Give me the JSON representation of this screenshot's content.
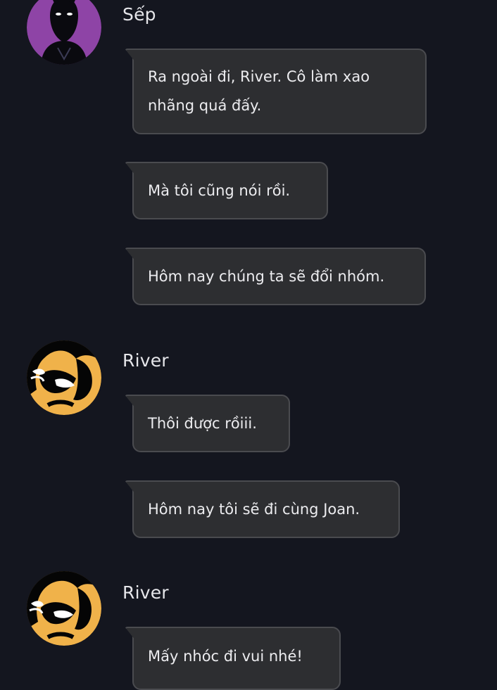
{
  "messages": [
    {
      "sender": "Sếp",
      "bubbles": [
        "Ra ngoài đi, River. Cô làm xao nhãng quá đấy.",
        "Mà tôi cũng nói rồi.",
        "Hôm nay chúng ta sẽ đổi nhóm."
      ]
    },
    {
      "sender": "River",
      "bubbles": [
        "Thôi được rồiii.",
        "Hôm nay tôi sẽ đi cùng Joan."
      ]
    },
    {
      "sender": "River",
      "bubbles": [
        "Mấy nhóc đi vui nhé!"
      ]
    }
  ]
}
